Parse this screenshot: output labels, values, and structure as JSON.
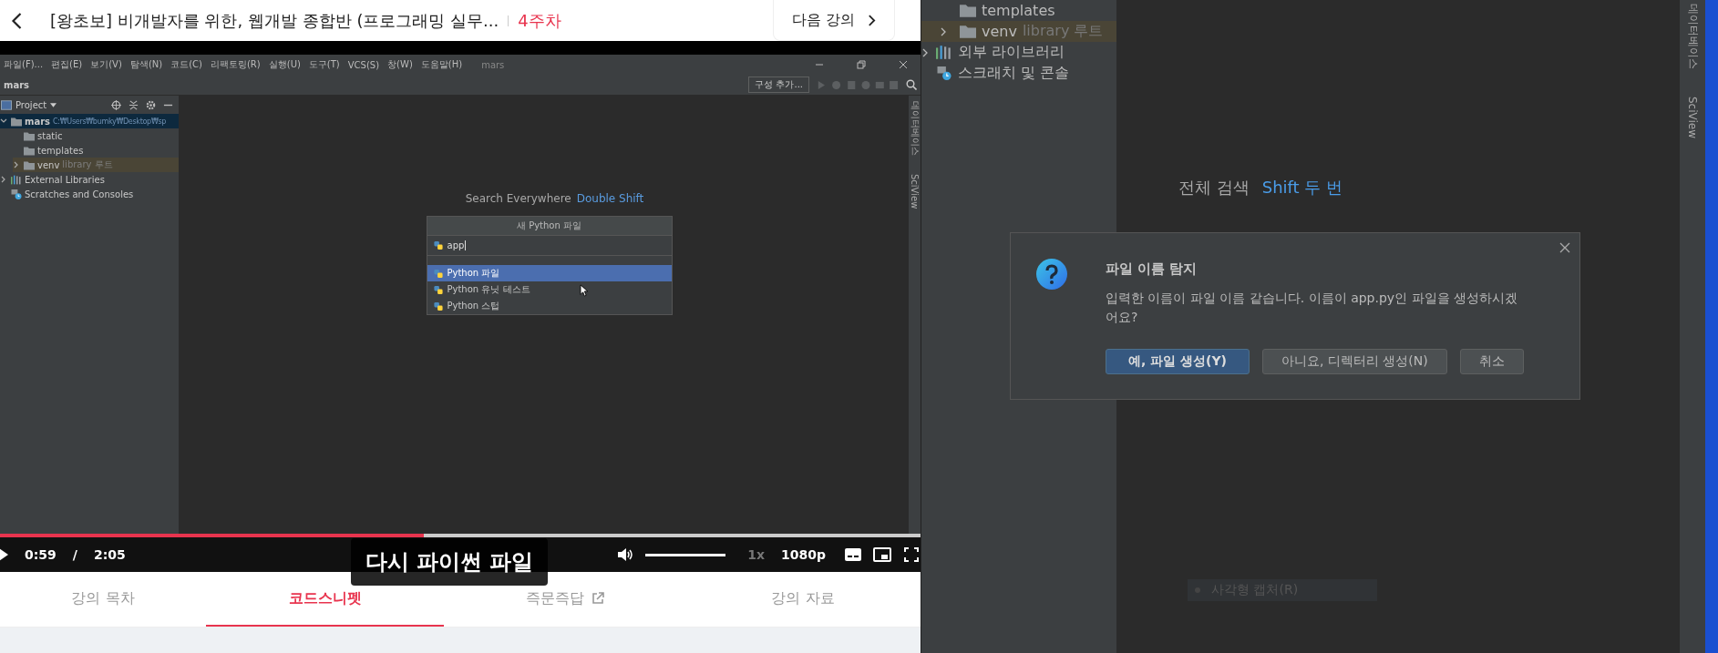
{
  "header": {
    "title": "[왕초보] 비개발자를 위한, 웹개발 종합반 (프로그래밍 실무...",
    "week": "4주차",
    "next_button": "다음 강의"
  },
  "video": {
    "ide": {
      "menu": [
        "파일(F)...",
        "편집(E)",
        "보기(V)",
        "탐색(N)",
        "코드(C)",
        "리팩토링(R)",
        "실행(U)",
        "도구(T)",
        "VCS(S)",
        "창(W)",
        "도움말(H)"
      ],
      "window_title": "mars",
      "breadcrumb": "mars",
      "config_button": "구성 추가...",
      "project_header": "Project",
      "tree": [
        {
          "label": "mars",
          "path": "C:₩Users₩bumky₩Desktop₩sp",
          "kind": "folder",
          "expanded": true,
          "selected": true,
          "children": [
            {
              "label": "static",
              "kind": "folder",
              "selected": false
            },
            {
              "label": "templates",
              "kind": "folder",
              "selected": false
            },
            {
              "label": "venv",
              "note": "library 루트",
              "kind": "library-folder",
              "expanded": false,
              "selected": false
            }
          ]
        },
        {
          "label": "External Libraries",
          "kind": "libraries",
          "expanded": false,
          "selected": false
        },
        {
          "label": "Scratches and Consoles",
          "kind": "scratches",
          "selected": false
        }
      ],
      "side_tabs": [
        "데이터베이스",
        "SciView"
      ],
      "search_hint": {
        "label": "Search Everywhere",
        "shortcut": "Double Shift"
      },
      "new_file_popup": {
        "title": "새 Python 파일",
        "value": "app",
        "options": [
          {
            "label": "Python 파일",
            "selected": true
          },
          {
            "label": "Python 유닛 테스트",
            "selected": false
          },
          {
            "label": "Python 스텁",
            "selected": false
          }
        ]
      }
    },
    "subtitle": "다시 파이썬 파일",
    "progress": {
      "level": 0.46
    },
    "time_current": "0:59",
    "time_separator": "/",
    "time_total": "2:05",
    "volume": {
      "level": 1
    },
    "speed": "1x",
    "quality": "1080p"
  },
  "tabs": [
    {
      "label": "강의 목차",
      "selected": false,
      "external": false
    },
    {
      "label": "코드스니펫",
      "selected": true,
      "external": false
    },
    {
      "label": "즉문즉답",
      "selected": false,
      "external": true
    },
    {
      "label": "강의 자료",
      "selected": false,
      "external": false
    }
  ],
  "ide": {
    "folders": [
      {
        "label": "templates",
        "kind": "folder"
      },
      {
        "label": "venv",
        "note": "library 루트",
        "kind": "library-folder",
        "expanded": false
      }
    ],
    "roots": [
      {
        "label": "외부 라이브러리",
        "kind": "libraries",
        "expanded": false
      },
      {
        "label": "스크래치 및 콘솔",
        "kind": "scratches"
      }
    ],
    "side_tabs": [
      "데이터베이스",
      "SciView"
    ],
    "search_hint": {
      "label": "전체 검색",
      "shortcut": "Shift 두 번"
    },
    "tooltip": "사각형 캡처(R)",
    "dialog": {
      "title": "파일 이름 탐지",
      "message": "입력한 이름이 파일 이름 같습니다. 이름이 app.py인 파일을 생성하시겠어요?",
      "buttons": [
        {
          "label": "예, 파일 생성(Y)",
          "default": true
        },
        {
          "label": "아니요, 디렉터리 생성(N)",
          "default": false
        },
        {
          "label": "취소",
          "default": false
        }
      ]
    }
  }
}
